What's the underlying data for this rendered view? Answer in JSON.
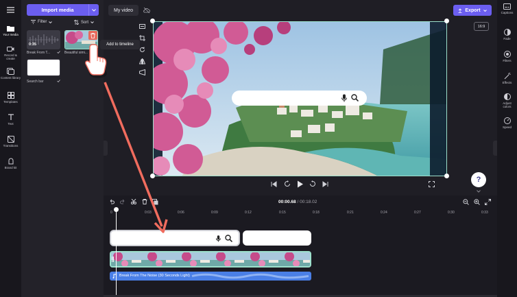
{
  "left_rail": {
    "items": [
      {
        "label": "Your media",
        "icon": "folder-icon"
      },
      {
        "label": "Record & create",
        "icon": "camera-icon"
      },
      {
        "label": "Content library",
        "icon": "library-icon"
      },
      {
        "label": "Templates",
        "icon": "templates-icon"
      },
      {
        "label": "Text",
        "icon": "text-icon"
      },
      {
        "label": "Transitions",
        "icon": "transitions-icon"
      },
      {
        "label": "Brand kit",
        "icon": "brand-kit-icon"
      }
    ]
  },
  "media_panel": {
    "import_label": "Import media",
    "filter_label": "Filter",
    "sort_label": "Sort",
    "items": [
      {
        "caption": "Break From T...",
        "duration": "0:35"
      },
      {
        "caption": "Beautiful simi..."
      },
      {
        "caption": "Search bar"
      }
    ],
    "tooltip": "Add to timeline"
  },
  "top_bar": {
    "project_title": "My video",
    "export_label": "Export",
    "aspect_ratio": "16:9"
  },
  "right_rail": {
    "items": [
      {
        "label": "Captions",
        "icon": "captions-icon"
      },
      {
        "label": "Fade",
        "icon": "fade-icon"
      },
      {
        "label": "Filters",
        "icon": "filters-icon"
      },
      {
        "label": "Effects",
        "icon": "effects-icon"
      },
      {
        "label": "Adjust colors",
        "icon": "adjust-colors-icon"
      },
      {
        "label": "Speed",
        "icon": "speed-icon"
      }
    ]
  },
  "timeline": {
    "current_time": "00:00.68",
    "total_time": "00:18.02",
    "ticks": [
      "0",
      "0:03",
      "0:06",
      "0:09",
      "0:12",
      "0:15",
      "0:18",
      "0:21",
      "0:24",
      "0:27",
      "0:30",
      "0:33"
    ],
    "audio_clip_label": "Break From The Noise (30 Seconds Light)"
  },
  "help_label": "?",
  "colors": {
    "accent": "#6b5ef0",
    "selection": "#9de0cc",
    "audio": "#4a7fe6",
    "arrow": "#f06c5e"
  }
}
